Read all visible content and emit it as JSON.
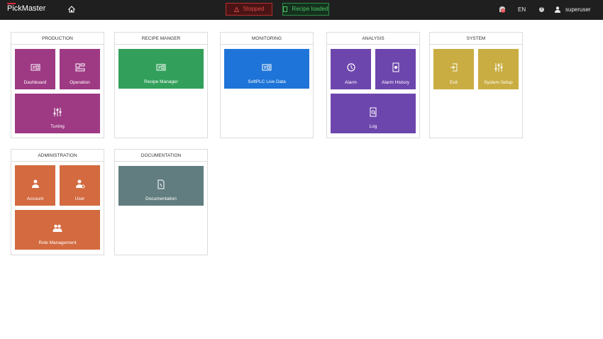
{
  "header": {
    "app_name": "PickMaster",
    "status_stopped": "Stopped",
    "status_recipe": "Recipe loaded",
    "notification_count": "0",
    "language": "EN",
    "help_glyph": "?",
    "username": "superuser"
  },
  "groups": {
    "production": {
      "title": "PRODUCTION",
      "tiles": [
        "Dashboard",
        "Operation",
        "Tuning"
      ]
    },
    "recipe": {
      "title": "RECIPE MANGER",
      "tiles": [
        "Recipe Manager"
      ]
    },
    "monitoring": {
      "title": "MONITORING",
      "tiles": [
        "SoftPLC Live Data"
      ]
    },
    "analysis": {
      "title": "ANALYSIS",
      "tiles": [
        "Alarm",
        "Alarm History",
        "Log"
      ]
    },
    "system": {
      "title": "SYSTEM",
      "tiles": [
        "Exit",
        "System Setup"
      ]
    },
    "administration": {
      "title": "ADMINISTRATION",
      "tiles": [
        "Account",
        "User",
        "Role  Management"
      ]
    },
    "documentation": {
      "title": "DOCUMENTATION",
      "tiles": [
        "Documentation"
      ]
    }
  },
  "colors": {
    "production": "#9e3a84",
    "recipe": "#32a05a",
    "monitoring": "#1e74d8",
    "analysis": "#6d46ad",
    "system": "#c9ad42",
    "administration": "#d36a40",
    "documentation": "#617d80"
  }
}
